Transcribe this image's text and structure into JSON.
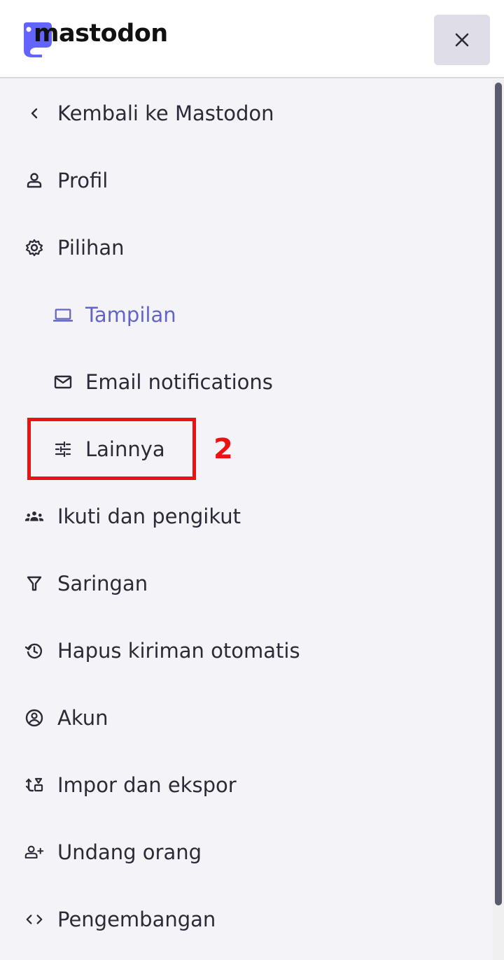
{
  "header": {
    "logo_text": "mastodon",
    "brand_color": "#6364ff",
    "close_icon": "close-icon"
  },
  "menu": {
    "back": {
      "label": "Kembali ke Mastodon",
      "icon": "chevron-left-icon"
    },
    "profile": {
      "label": "Profil",
      "icon": "person-icon"
    },
    "preferences": {
      "label": "Pilihan",
      "icon": "gear-icon"
    },
    "appearance": {
      "label": "Tampilan",
      "icon": "laptop-icon",
      "active": true
    },
    "email": {
      "label": "Email notifications",
      "icon": "mail-icon"
    },
    "other": {
      "label": "Lainnya",
      "icon": "sliders-icon"
    },
    "relationships": {
      "label": "Ikuti dan pengikut",
      "icon": "group-icon"
    },
    "filters": {
      "label": "Saringan",
      "icon": "filter-icon"
    },
    "auto_delete": {
      "label": "Hapus kiriman otomatis",
      "icon": "history-icon"
    },
    "account": {
      "label": "Akun",
      "icon": "account-circle-icon"
    },
    "import_export": {
      "label": "Impor dan ekspor",
      "icon": "import-export-icon"
    },
    "invites": {
      "label": "Undang orang",
      "icon": "person-add-icon"
    },
    "development": {
      "label": "Pengembangan",
      "icon": "code-icon"
    }
  },
  "annotation": {
    "step_number": "2",
    "color": "#ee1111"
  },
  "colors": {
    "active": "#6364c8",
    "text": "#2b2a37",
    "background": "#f4f4f8"
  }
}
